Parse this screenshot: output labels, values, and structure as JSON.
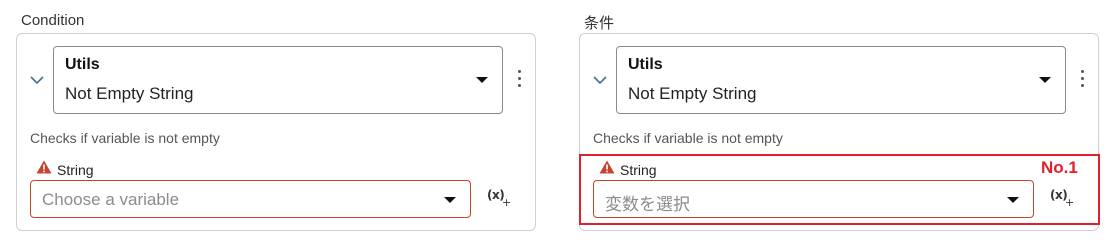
{
  "panels": [
    {
      "title": "Condition",
      "function_group": "Utils",
      "function_name": "Not Empty String",
      "description": "Checks if variable is not empty",
      "param_label": "String",
      "variable_placeholder": "Choose a variable",
      "fx_label": "(x)",
      "fx_plus": "+"
    },
    {
      "title": "条件",
      "function_group": "Utils",
      "function_name": "Not Empty String",
      "description": "Checks if variable is not empty",
      "param_label": "String",
      "variable_placeholder": "変数を選択",
      "fx_label": "(x)",
      "fx_plus": "+"
    }
  ],
  "annotation": {
    "label": "No.1",
    "color": "#e0202a"
  },
  "colors": {
    "error_border": "#c4442c",
    "warning_icon": "#c4442c"
  },
  "icons": [
    "chevron-down-icon",
    "caret-down-icon",
    "kebab-menu-icon",
    "warning-icon",
    "variable-fx-icon"
  ]
}
